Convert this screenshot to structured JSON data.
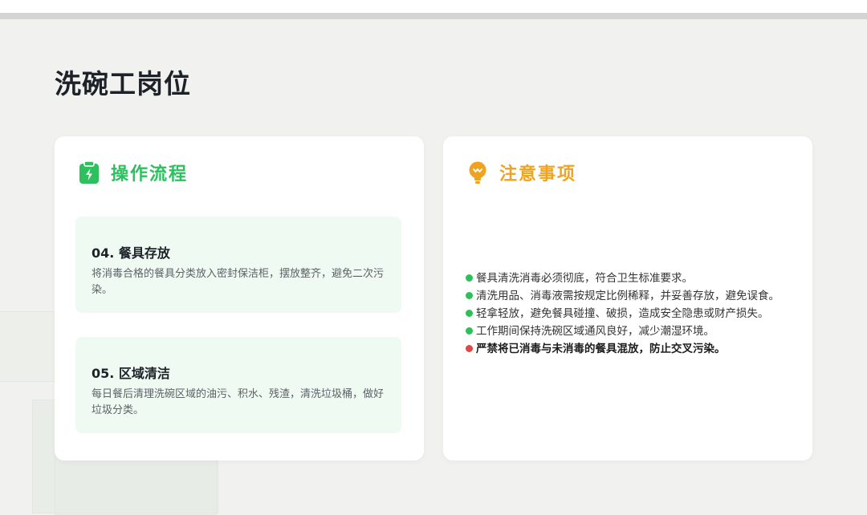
{
  "page": {
    "title": "洗碗工岗位"
  },
  "colors": {
    "green": "#2ec05f",
    "orange": "#f0a31e",
    "warning_dot": "#e04848",
    "step_bg": "#effaf2"
  },
  "process": {
    "icon": "clipboard-icon",
    "title": "操作流程",
    "steps": [
      {
        "title": "04. 餐具存放",
        "desc": "将消毒合格的餐具分类放入密封保洁柜，摆放整齐，避免二次污染。"
      },
      {
        "title": "05. 区域清洁",
        "desc": "每日餐后清理洗碗区域的油污、积水、残渣，清洗垃圾桶，做好垃圾分类。"
      }
    ]
  },
  "notes": {
    "icon": "lightbulb-icon",
    "title": "注意事项",
    "items": [
      {
        "text": "餐具清洗消毒必须彻底，符合卫生标准要求。",
        "level": "normal"
      },
      {
        "text": "清洗用品、消毒液需按规定比例稀释，并妥善存放，避免误食。",
        "level": "normal"
      },
      {
        "text": "轻拿轻放，避免餐具碰撞、破损，造成安全隐患或财产损失。",
        "level": "normal"
      },
      {
        "text": "工作期间保持洗碗区域通风良好，减少潮湿环境。",
        "level": "normal"
      },
      {
        "text": "严禁将已消毒与未消毒的餐具混放，防止交叉污染。",
        "level": "warning"
      }
    ]
  }
}
